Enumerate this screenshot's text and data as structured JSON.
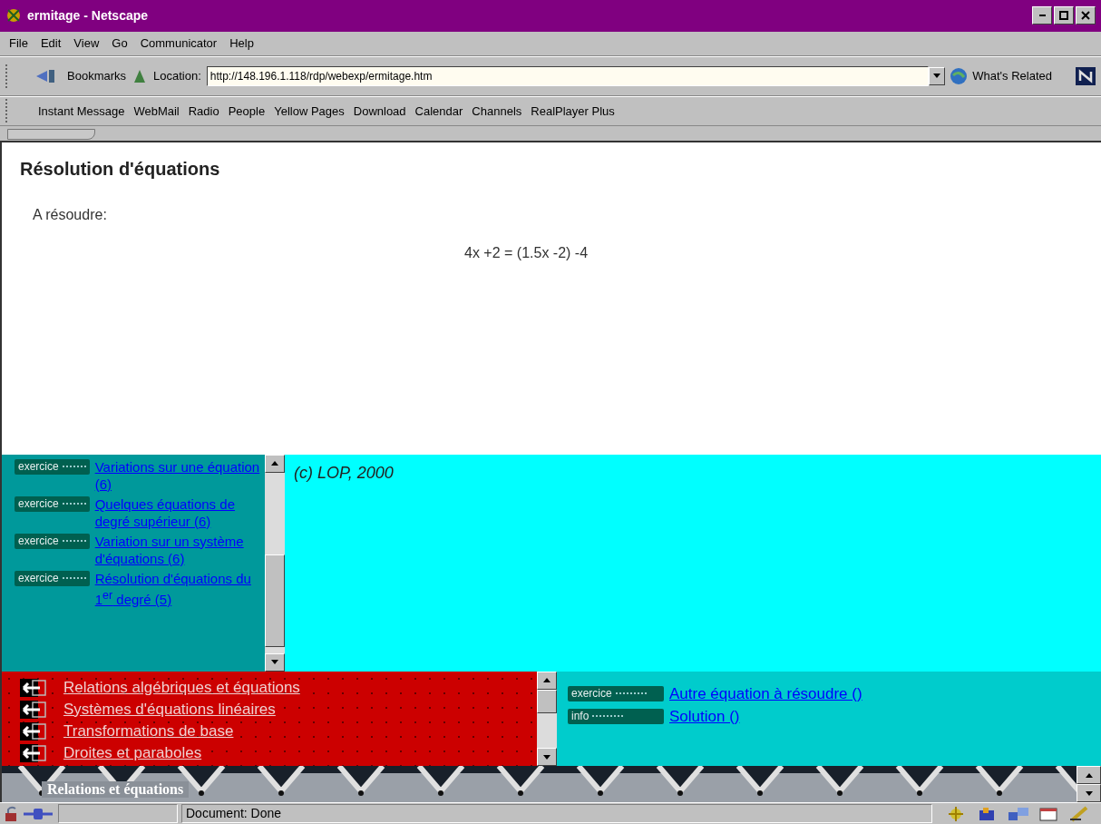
{
  "window": {
    "title": "ermitage - Netscape"
  },
  "menu": [
    "File",
    "Edit",
    "View",
    "Go",
    "Communicator",
    "Help"
  ],
  "location_bar": {
    "bookmarks": "Bookmarks",
    "label": "Location:",
    "url": "http://148.196.1.118/rdp/webexp/ermitage.htm",
    "related": "What's Related"
  },
  "personal_toolbar": [
    "Instant Message",
    "WebMail",
    "Radio",
    "People",
    "Yellow Pages",
    "Download",
    "Calendar",
    "Channels",
    "RealPlayer Plus"
  ],
  "page": {
    "heading": "Résolution d'équations",
    "prompt": "A résoudre:",
    "equation": "4x +2 = (1.5x -2) -4"
  },
  "exercise_list": [
    {
      "badge": "exercice",
      "link": "Variations sur une équation (6)"
    },
    {
      "badge": "exercice",
      "link": "Quelques équations de degré supérieur (6)"
    },
    {
      "badge": "exercice",
      "link": "Variation sur un système d'équations (6)"
    },
    {
      "badge": "exercice",
      "link": "Résolution d'équations du 1$^{er}$ degré (5)"
    }
  ],
  "copyright": "(c) LOP, 2000",
  "chapters": [
    "Relations algébriques et équations",
    "Systèmes d'équations linéaires",
    "Transformations de base",
    "Droites et paraboles"
  ],
  "actions": [
    {
      "badge": "exercice",
      "link": "Autre équation à résoudre ()"
    },
    {
      "badge": "info",
      "link": "Solution ()"
    }
  ],
  "banner": "Relations et équations",
  "status_bar": {
    "text": "Document: Done"
  }
}
